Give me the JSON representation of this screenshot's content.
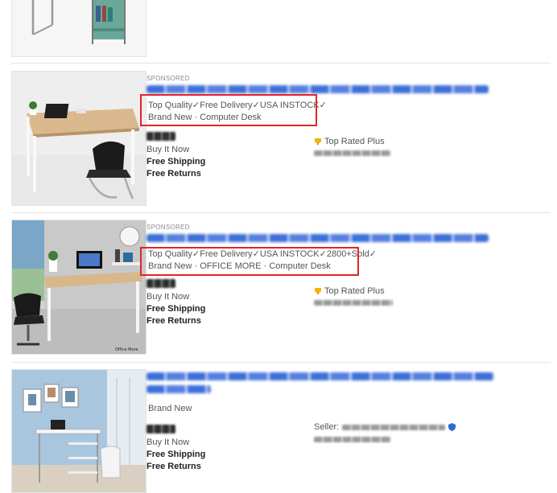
{
  "listings": [
    {
      "id": "prev-item",
      "partial": true
    },
    {
      "sponsored": "SPONSORED",
      "highlight": "Top Quality✓Free Delivery✓USA INSTOCK✓",
      "subtitle": "Brand New · Computer Desk",
      "buy": "Buy It Now",
      "shipping": "Free Shipping",
      "returns": "Free Returns",
      "badge": "Top Rated Plus"
    },
    {
      "sponsored": "SPONSORED",
      "highlight": "Top Quality✓Free Delivery✓USA INSTOCK✓2800+Sold✓",
      "subtitle": "Brand New · OFFICE MORE · Computer Desk",
      "buy": "Buy It Now",
      "shipping": "Free Shipping",
      "returns": "Free Returns",
      "badge": "Top Rated Plus",
      "watermark": "Office More"
    },
    {
      "subtitle": "Brand New",
      "buy": "Buy It Now",
      "shipping": "Free Shipping",
      "returns": "Free Returns",
      "seller_label": "Seller:"
    }
  ],
  "colors": {
    "highlight_box": "#e0242b",
    "link_blur": "#3d6fd8",
    "badge_gold": "#f2b400"
  }
}
